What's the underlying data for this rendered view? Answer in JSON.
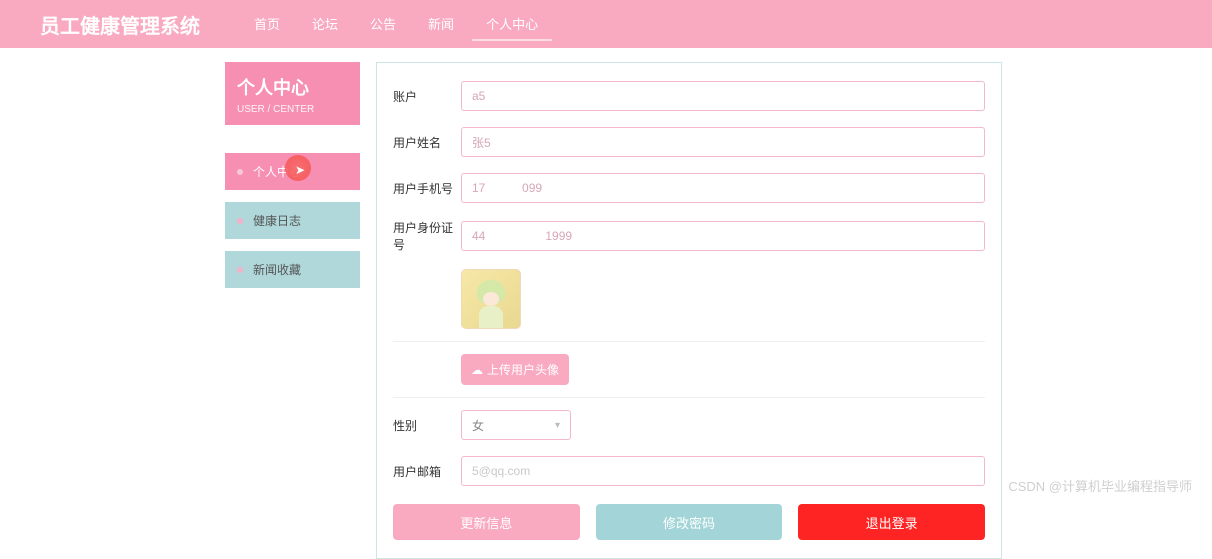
{
  "header": {
    "logo": "员工健康管理系统",
    "nav": [
      {
        "label": "首页",
        "active": false
      },
      {
        "label": "论坛",
        "active": false
      },
      {
        "label": "公告",
        "active": false
      },
      {
        "label": "新闻",
        "active": false
      },
      {
        "label": "个人中心",
        "active": true
      }
    ]
  },
  "sidebar": {
    "title": "个人中心",
    "subtitle": "USER / CENTER",
    "items": [
      {
        "label": "个人中心",
        "active": true
      },
      {
        "label": "健康日志",
        "active": false
      },
      {
        "label": "新闻收藏",
        "active": false
      }
    ]
  },
  "form": {
    "account": {
      "label": "账户",
      "value": "a5"
    },
    "username": {
      "label": "用户姓名",
      "value": "张5"
    },
    "phone": {
      "label": "用户手机号",
      "value": "17           099"
    },
    "idcard": {
      "label": "用户身份证号",
      "value": "44                  1999"
    },
    "upload_btn": "上传用户头像",
    "gender": {
      "label": "性别",
      "value": "女"
    },
    "email": {
      "label": "用户邮箱",
      "value": "5@qq.com"
    }
  },
  "actions": {
    "update": "更新信息",
    "change_password": "修改密码",
    "logout": "退出登录"
  },
  "watermark": "CSDN @计算机毕业编程指导师"
}
